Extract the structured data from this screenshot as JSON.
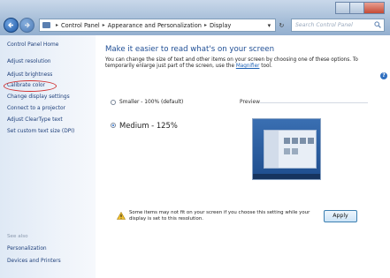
{
  "titlebar": {
    "window_controls": [
      "minimize",
      "maximize",
      "close"
    ]
  },
  "navigation": {
    "back_icon": "back-arrow-icon",
    "forward_icon": "forward-arrow-icon"
  },
  "address_bar": {
    "folder_icon": "control-panel-folder-icon",
    "crumbs": [
      "Control Panel",
      "Appearance and Personalization",
      "Display"
    ]
  },
  "search": {
    "placeholder": "Search Control Panel",
    "icon": "search-icon"
  },
  "left_pane": {
    "home_link": "Control Panel Home",
    "links": [
      "Adjust resolution",
      "Adjust brightness",
      "Calibrate color",
      "Change display settings",
      "Connect to a projector",
      "Adjust ClearType text",
      "Set custom text size (DPI)"
    ],
    "see_also_title": "See also",
    "see_also_links": [
      "Personalization",
      "Devices and Printers"
    ],
    "highlight_color": "#d03030"
  },
  "main": {
    "heading": "Make it easier to read what's on your screen",
    "description_part1": "You can change the size of text and other items on your screen by choosing one of these options. To temporarily enlarge just part of the screen, use the ",
    "description_link": "Magnifier",
    "description_part2": " tool.",
    "options": [
      {
        "label": "Smaller - 100% (default)",
        "selected": false
      },
      {
        "label": "Medium - 125%",
        "selected": true
      }
    ],
    "preview_label": "Preview",
    "warning_icon": "warning-icon",
    "warning_text": "Some items may not fit on your screen if you choose this setting while your display is set to this resolution.",
    "apply_label": "Apply",
    "help_icon": "help-icon"
  },
  "colors": {
    "link": "#1e3f7a",
    "heading": "#1f4e95",
    "accent": "#2a6fcf"
  }
}
